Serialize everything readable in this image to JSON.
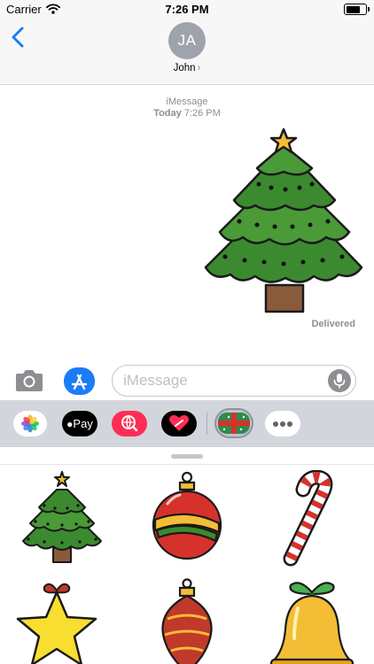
{
  "status_bar": {
    "carrier": "Carrier",
    "time": "7:26 PM",
    "battery_level": 0.78
  },
  "header": {
    "avatar_initials": "JA",
    "contact_name": "John",
    "contact_chevron": "›"
  },
  "conversation": {
    "service_label": "iMessage",
    "timestamp_day": "Today",
    "timestamp_time": "7:26 PM",
    "sent_sticker": "christmas-tree-sticker",
    "delivery_status": "Delivered"
  },
  "compose": {
    "placeholder": "iMessage",
    "value": ""
  },
  "app_drawer": {
    "apps": [
      {
        "name": "photos-app",
        "label": ""
      },
      {
        "name": "apple-pay-app",
        "label": "Pay"
      },
      {
        "name": "web-search-app",
        "label": ""
      },
      {
        "name": "digital-touch-app",
        "label": ""
      },
      {
        "name": "christmas-stickers-app",
        "label": ""
      },
      {
        "name": "more-apps",
        "label": ""
      }
    ]
  },
  "sticker_sheet": {
    "stickers": [
      "christmas-tree",
      "red-ornament-ball",
      "candy-cane",
      "yellow-star-ornament",
      "red-drop-ornament",
      "golden-bell"
    ]
  },
  "colors": {
    "accent_blue": "#1b7cf5",
    "tree_green": "#3c8a2f",
    "ornament_red": "#d6322b",
    "gold": "#f4bd36"
  }
}
